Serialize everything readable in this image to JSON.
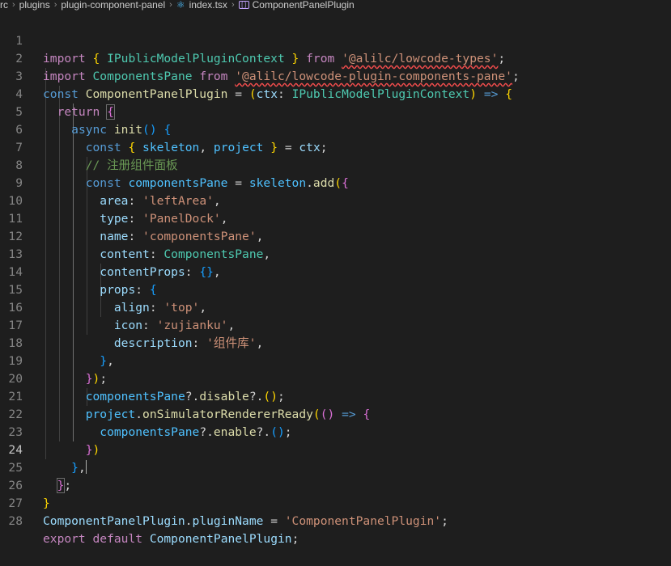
{
  "breadcrumb": {
    "items": [
      "rc",
      "plugins",
      "plugin-component-panel",
      "index.tsx",
      "ComponentPanelPlugin"
    ]
  },
  "editor": {
    "active_line": 24,
    "line_numbers": [
      "1",
      "2",
      "3",
      "4",
      "5",
      "6",
      "7",
      "8",
      "9",
      "10",
      "11",
      "12",
      "13",
      "14",
      "15",
      "16",
      "17",
      "18",
      "19",
      "20",
      "21",
      "22",
      "23",
      "24",
      "25",
      "26",
      "27",
      "28"
    ],
    "tokens": {
      "l1": [
        "import",
        " ",
        "{",
        " IPublicModelPluginContext ",
        "}",
        " from ",
        "'@alilc/lowcode-types'",
        ";"
      ],
      "l2": [
        "import",
        " ComponentsPane ",
        "from",
        " ",
        "'@alilc/lowcode-plugin-components-pane'",
        ";"
      ],
      "l3": [
        "const",
        " ComponentPanelPlugin ",
        "=",
        " ",
        "(",
        "ctx",
        ": ",
        "IPublicModelPluginContext",
        ")",
        " ",
        "=>",
        " ",
        "{"
      ],
      "l4": [
        "return",
        " ",
        "{"
      ],
      "l5": [
        "async",
        " ",
        "init",
        "(",
        ")",
        " ",
        "{"
      ],
      "l6": [
        "const",
        " ",
        "{",
        " ",
        "skeleton",
        ", ",
        "project",
        " ",
        "}",
        " = ",
        "ctx",
        ";"
      ],
      "l7": [
        "// 注册组件面板"
      ],
      "l8": [
        "const",
        " ",
        "componentsPane",
        " = ",
        "skeleton",
        ".",
        "add",
        "(",
        "{"
      ],
      "l9": [
        "area",
        ": ",
        "'leftArea'",
        ","
      ],
      "l10": [
        "type",
        ": ",
        "'PanelDock'",
        ","
      ],
      "l11": [
        "name",
        ": ",
        "'componentsPane'",
        ","
      ],
      "l12": [
        "content",
        ": ",
        "ComponentsPane",
        ","
      ],
      "l13": [
        "contentProps",
        ": ",
        "{}",
        ","
      ],
      "l14": [
        "props",
        ": ",
        "{"
      ],
      "l15": [
        "align",
        ": ",
        "'top'",
        ","
      ],
      "l16": [
        "icon",
        ": ",
        "'zujianku'",
        ","
      ],
      "l17": [
        "description",
        ": ",
        "'组件库'",
        ","
      ],
      "l18": [
        "}",
        ","
      ],
      "l19": [
        "}",
        ")",
        ";"
      ],
      "l20": [
        "componentsPane",
        "?.",
        "disable",
        "?.",
        "(",
        ")",
        ";"
      ],
      "l21": [
        "project",
        ".",
        "onSimulatorRendererReady",
        "(",
        "(",
        ")",
        " ",
        "=>",
        " ",
        "{"
      ],
      "l22": [
        "componentsPane",
        "?.",
        "enable",
        "?.",
        "(",
        ")",
        ";"
      ],
      "l23": [
        "}",
        ")"
      ],
      "l24": [
        "}",
        ","
      ],
      "l25": [
        "}",
        ";"
      ],
      "l26": [
        "}"
      ],
      "l27": [
        "ComponentPanelPlugin",
        ".",
        "pluginName",
        " = ",
        "'ComponentPanelPlugin'",
        ";"
      ],
      "l28": [
        "export",
        " ",
        "default",
        " ",
        "ComponentPanelPlugin",
        ";"
      ]
    }
  }
}
